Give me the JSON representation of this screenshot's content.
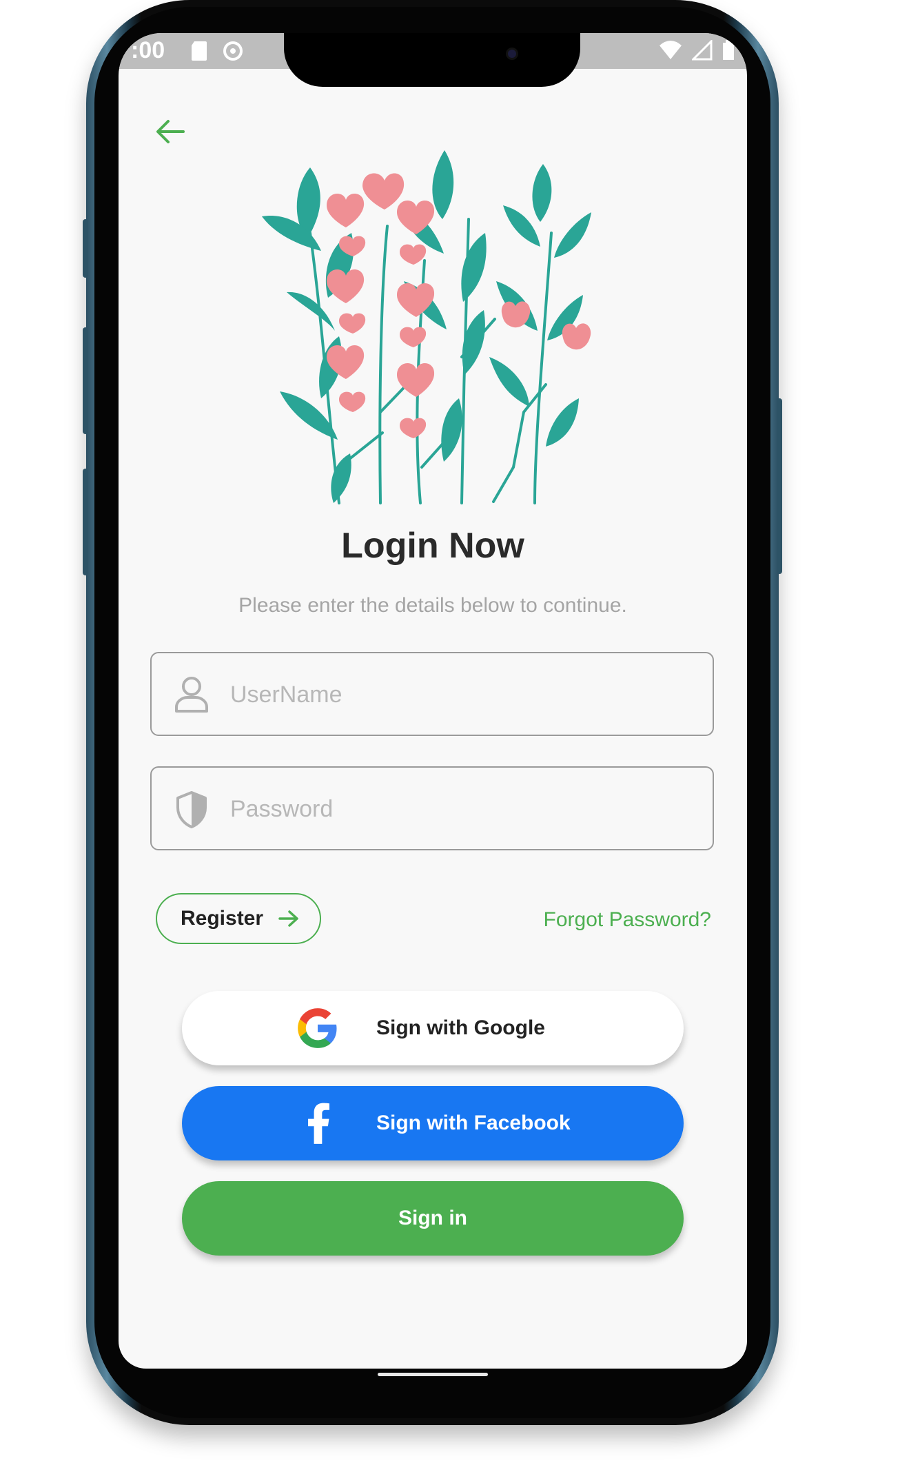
{
  "status_bar": {
    "time": ":00",
    "left_icons": [
      "sd-card-icon",
      "sync-icon"
    ],
    "right_icons": [
      "wifi-icon",
      "signal-icon",
      "battery-icon"
    ]
  },
  "header": {
    "back_icon": "arrow-left-icon"
  },
  "login": {
    "title": "Login Now",
    "subtitle": "Please enter the details below to continue.",
    "username": {
      "placeholder": "UserName",
      "value": "",
      "icon": "user-icon"
    },
    "password": {
      "placeholder": "Password",
      "value": "",
      "icon": "shield-icon"
    },
    "register_label": "Register",
    "forgot_label": "Forgot Password?",
    "google_label": "Sign with Google",
    "facebook_label": "Sign with Facebook",
    "signin_label": "Sign in"
  },
  "colors": {
    "accent": "#4caf50",
    "facebook": "#1877f2",
    "leaf": "#2aa596",
    "petal": "#ef8f94",
    "screen_bg": "#f8f8f8"
  }
}
